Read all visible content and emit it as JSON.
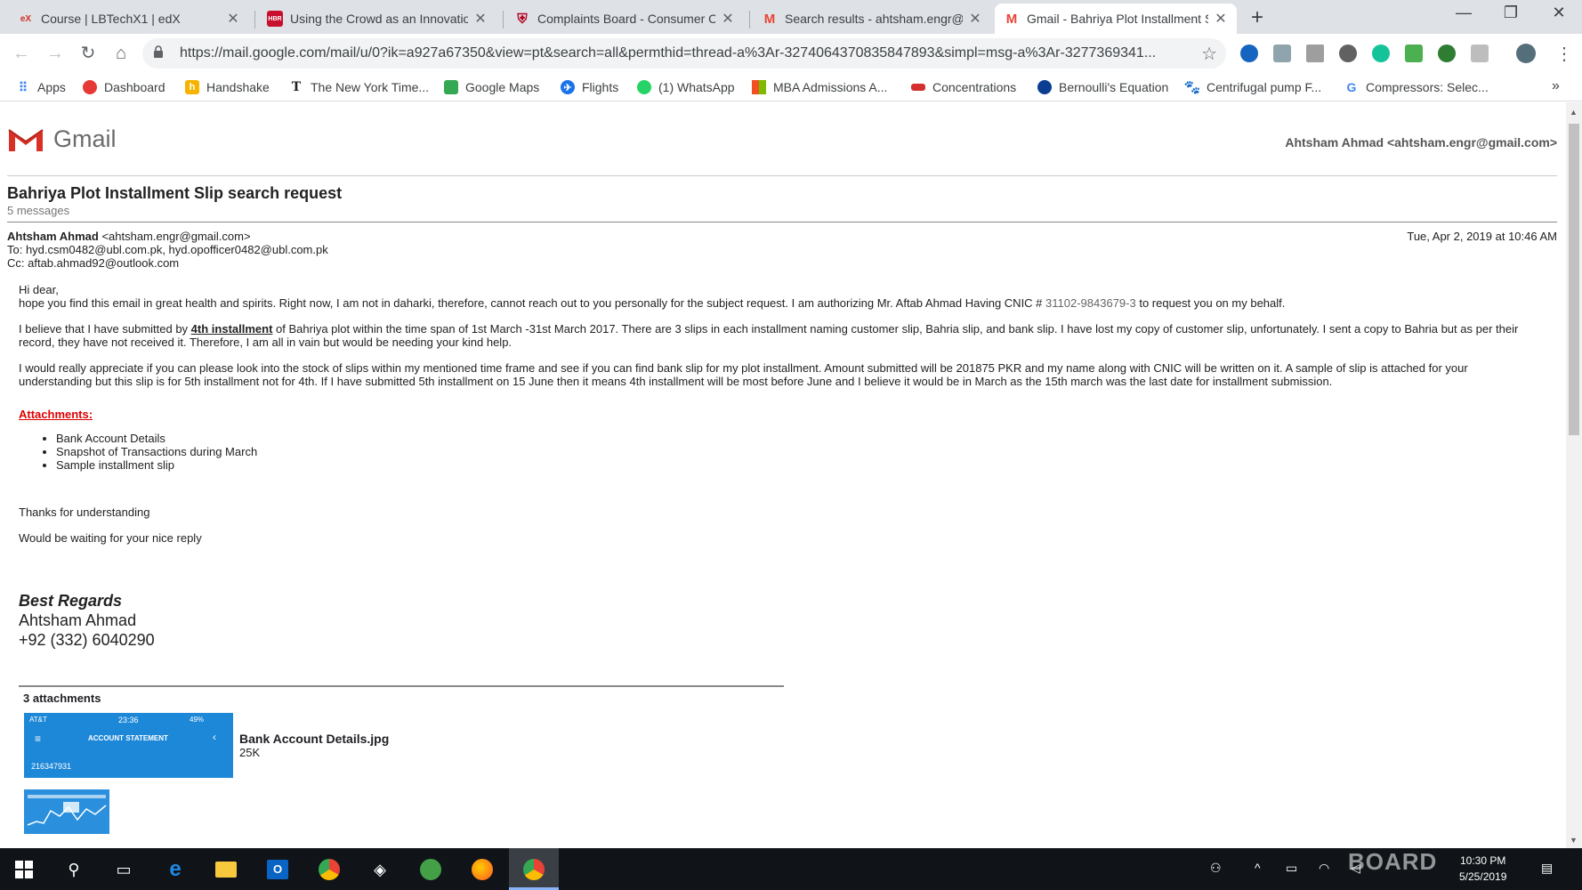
{
  "browser": {
    "tabs": [
      {
        "title": "Course | LBTechX1 | edX",
        "favicon": "edx-icon",
        "fav_text": "eX",
        "fav_color": "#d23228"
      },
      {
        "title": "Using the Crowd as an Innovatio",
        "favicon": "hbr-icon",
        "fav_text": "HBR",
        "fav_color": "#c8102e"
      },
      {
        "title": "Complaints Board - Consumer Co",
        "favicon": "shield-icon",
        "fav_text": "⛨",
        "fav_color": "#b00020"
      },
      {
        "title": "Search results - ahtsham.engr@g",
        "favicon": "gmail-icon",
        "fav_text": "M",
        "fav_color": "#ea4335"
      },
      {
        "title": "Gmail - Bahriya Plot Installment S",
        "favicon": "gmail-icon",
        "fav_text": "M",
        "fav_color": "#ea4335"
      }
    ],
    "url": "https://mail.google.com/mail/u/0?ik=a927a67350&view=pt&search=all&permthid=thread-a%3Ar-3274064370835847893&simpl=msg-a%3Ar-3277369341...",
    "bookmarks": [
      {
        "label": "Apps",
        "icon": "apps-grid-icon",
        "color": "#4285f4"
      },
      {
        "label": "Dashboard",
        "icon": "dashboard-icon",
        "color": "#e53935"
      },
      {
        "label": "Handshake",
        "icon": "handshake-icon",
        "color": "#f4b400"
      },
      {
        "label": "The New York Time...",
        "icon": "nyt-icon",
        "color": "#222222"
      },
      {
        "label": "Google Maps",
        "icon": "maps-icon",
        "color": "#34a853"
      },
      {
        "label": "Flights",
        "icon": "flights-icon",
        "color": "#1a73e8"
      },
      {
        "label": "(1) WhatsApp",
        "icon": "whatsapp-icon",
        "color": "#25d366"
      },
      {
        "label": "MBA Admissions A...",
        "icon": "mba-icon",
        "color": "#f25022"
      },
      {
        "label": "Concentrations",
        "icon": "concentrations-icon",
        "color": "#d32f2f"
      },
      {
        "label": "Bernoulli's Equation",
        "icon": "nasa-icon",
        "color": "#0b3d91"
      },
      {
        "label": "Centrifugal pump F...",
        "icon": "paw-icon",
        "color": "#333333"
      },
      {
        "label": "Compressors: Selec...",
        "icon": "google-icon",
        "color": "#4285f4"
      }
    ]
  },
  "email": {
    "logo_text": "Gmail",
    "account": "Ahtsham Ahmad <ahtsham.engr@gmail.com>",
    "subject": "Bahriya Plot Installment Slip search request",
    "message_count": "5 messages",
    "from_name": "Ahtsham Ahmad",
    "from_email": "<ahtsham.engr@gmail.com>",
    "to": "To: hyd.csm0482@ubl.com.pk, hyd.opofficer0482@ubl.com.pk",
    "cc": "Cc: aftab.ahmad92@outlook.com",
    "date": "Tue, Apr 2, 2019 at 10:46 AM",
    "greeting": "Hi dear,",
    "p1_a": "hope you find this email in great health and spirits. Right now, I am not in daharki, therefore, cannot reach out to you personally for the subject request. I am authorizing Mr. Aftab Ahmad Having CNIC # ",
    "p1_cnic": "31102-9843679-3",
    "p1_b": " to request you on my behalf.",
    "p2_a": "I believe that I have submitted by ",
    "p2_u": "4th installment",
    "p2_b": " of Bahriya plot within the time span of 1st March -31st March 2017. There are 3 slips in each installment naming customer slip, Bahria slip, and bank slip. I have lost my copy of customer slip, unfortunately. I sent a copy to Bahria but as per their record, they have not received it. Therefore, I am all in vain but would be needing your kind help.",
    "p3": "I would really appreciate if you can please look into the stock of slips within my mentioned time frame and see if you can find bank slip for my plot installment. Amount submitted will be 201875 PKR and my name along with CNIC will be written on it. A sample of slip is attached for your understanding but this slip is for 5th installment not for 4th. If I have submitted 5th installment on 15 June then it means 4th installment will be most before June and I believe it would be in March as the 15th march was the last date for installment submission.",
    "attachments_heading": "Attachments:",
    "attachment_list": [
      "Bank Account Details",
      "Snapshot of Transactions during March",
      "Sample installment slip"
    ],
    "thanks": "Thanks for understanding",
    "waiting": "Would be waiting for your nice reply",
    "sig_regards": "Best Regards",
    "sig_name": "Ahtsham Ahmad",
    "sig_phone": "+92 (332) 6040290",
    "attachments_count": "3 attachments",
    "attachment_file_name": "Bank Account Details.jpg",
    "attachment_file_size": "25K",
    "thumb1_status": "AT&T",
    "thumb1_time": "23:36",
    "thumb1_battery": "49%",
    "thumb1_header": "ACCOUNT STATEMENT",
    "thumb1_account": "216347931"
  },
  "taskbar": {
    "time": "10:30 PM",
    "date": "5/25/2019",
    "watermark": "BOARD"
  }
}
